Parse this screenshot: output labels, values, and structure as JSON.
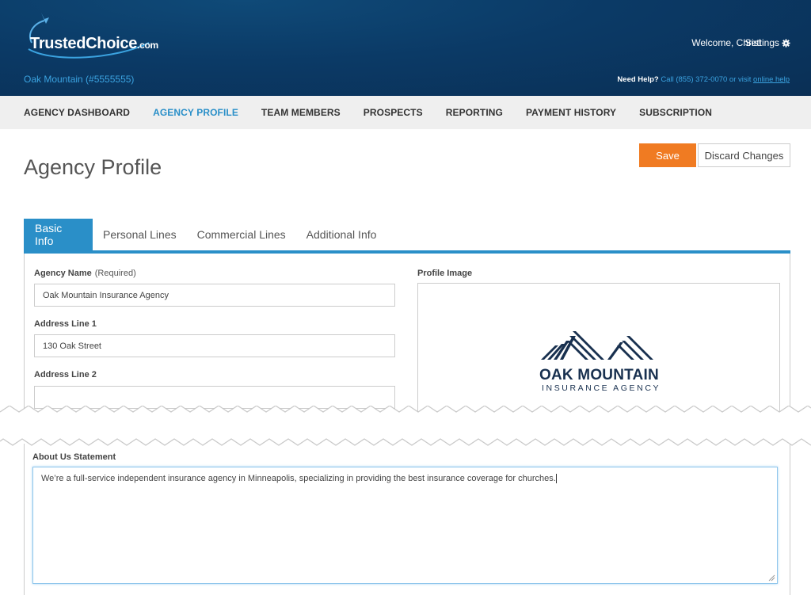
{
  "header": {
    "logo_text": "TrustedChoice",
    "logo_domain": ".com",
    "welcome": "Welcome, Chris!",
    "settings_label": "Settings",
    "agency_id": "Oak Mountain (#5555555)",
    "help_label": "Need Help?",
    "help_text": "Call (855) 372-0070 or visit",
    "help_link": "online help"
  },
  "nav": {
    "items": [
      {
        "label": "AGENCY DASHBOARD"
      },
      {
        "label": "AGENCY PROFILE"
      },
      {
        "label": "TEAM MEMBERS"
      },
      {
        "label": "PROSPECTS"
      },
      {
        "label": "REPORTING"
      },
      {
        "label": "PAYMENT HISTORY"
      },
      {
        "label": "SUBSCRIPTION"
      }
    ],
    "active": "AGENCY PROFILE"
  },
  "page": {
    "title": "Agency Profile",
    "save_label": "Save",
    "discard_label": "Discard Changes"
  },
  "tabs": [
    {
      "label": "Basic Info"
    },
    {
      "label": "Personal Lines"
    },
    {
      "label": "Commercial Lines"
    },
    {
      "label": "Additional Info"
    }
  ],
  "form": {
    "agency_name_label": "Agency Name",
    "agency_name_required": "(Required)",
    "agency_name_value": "Oak Mountain Insurance Agency",
    "address1_label": "Address Line 1",
    "address1_value": "130 Oak Street",
    "address2_label": "Address Line 2",
    "address2_value": "",
    "profile_image_label": "Profile Image",
    "profile_logo_title": "OAK MOUNTAIN",
    "profile_logo_sub": "INSURANCE AGENCY",
    "about_label": "About Us Statement",
    "about_value": "We’re a full-service independent insurance agency in Minneapolis, specializing in providing the best insurance coverage for churches."
  },
  "colors": {
    "header_bg": "#0b3a66",
    "accent_blue": "#2a8fc8",
    "save_orange": "#f07b22",
    "nav_bg": "#efefef"
  }
}
